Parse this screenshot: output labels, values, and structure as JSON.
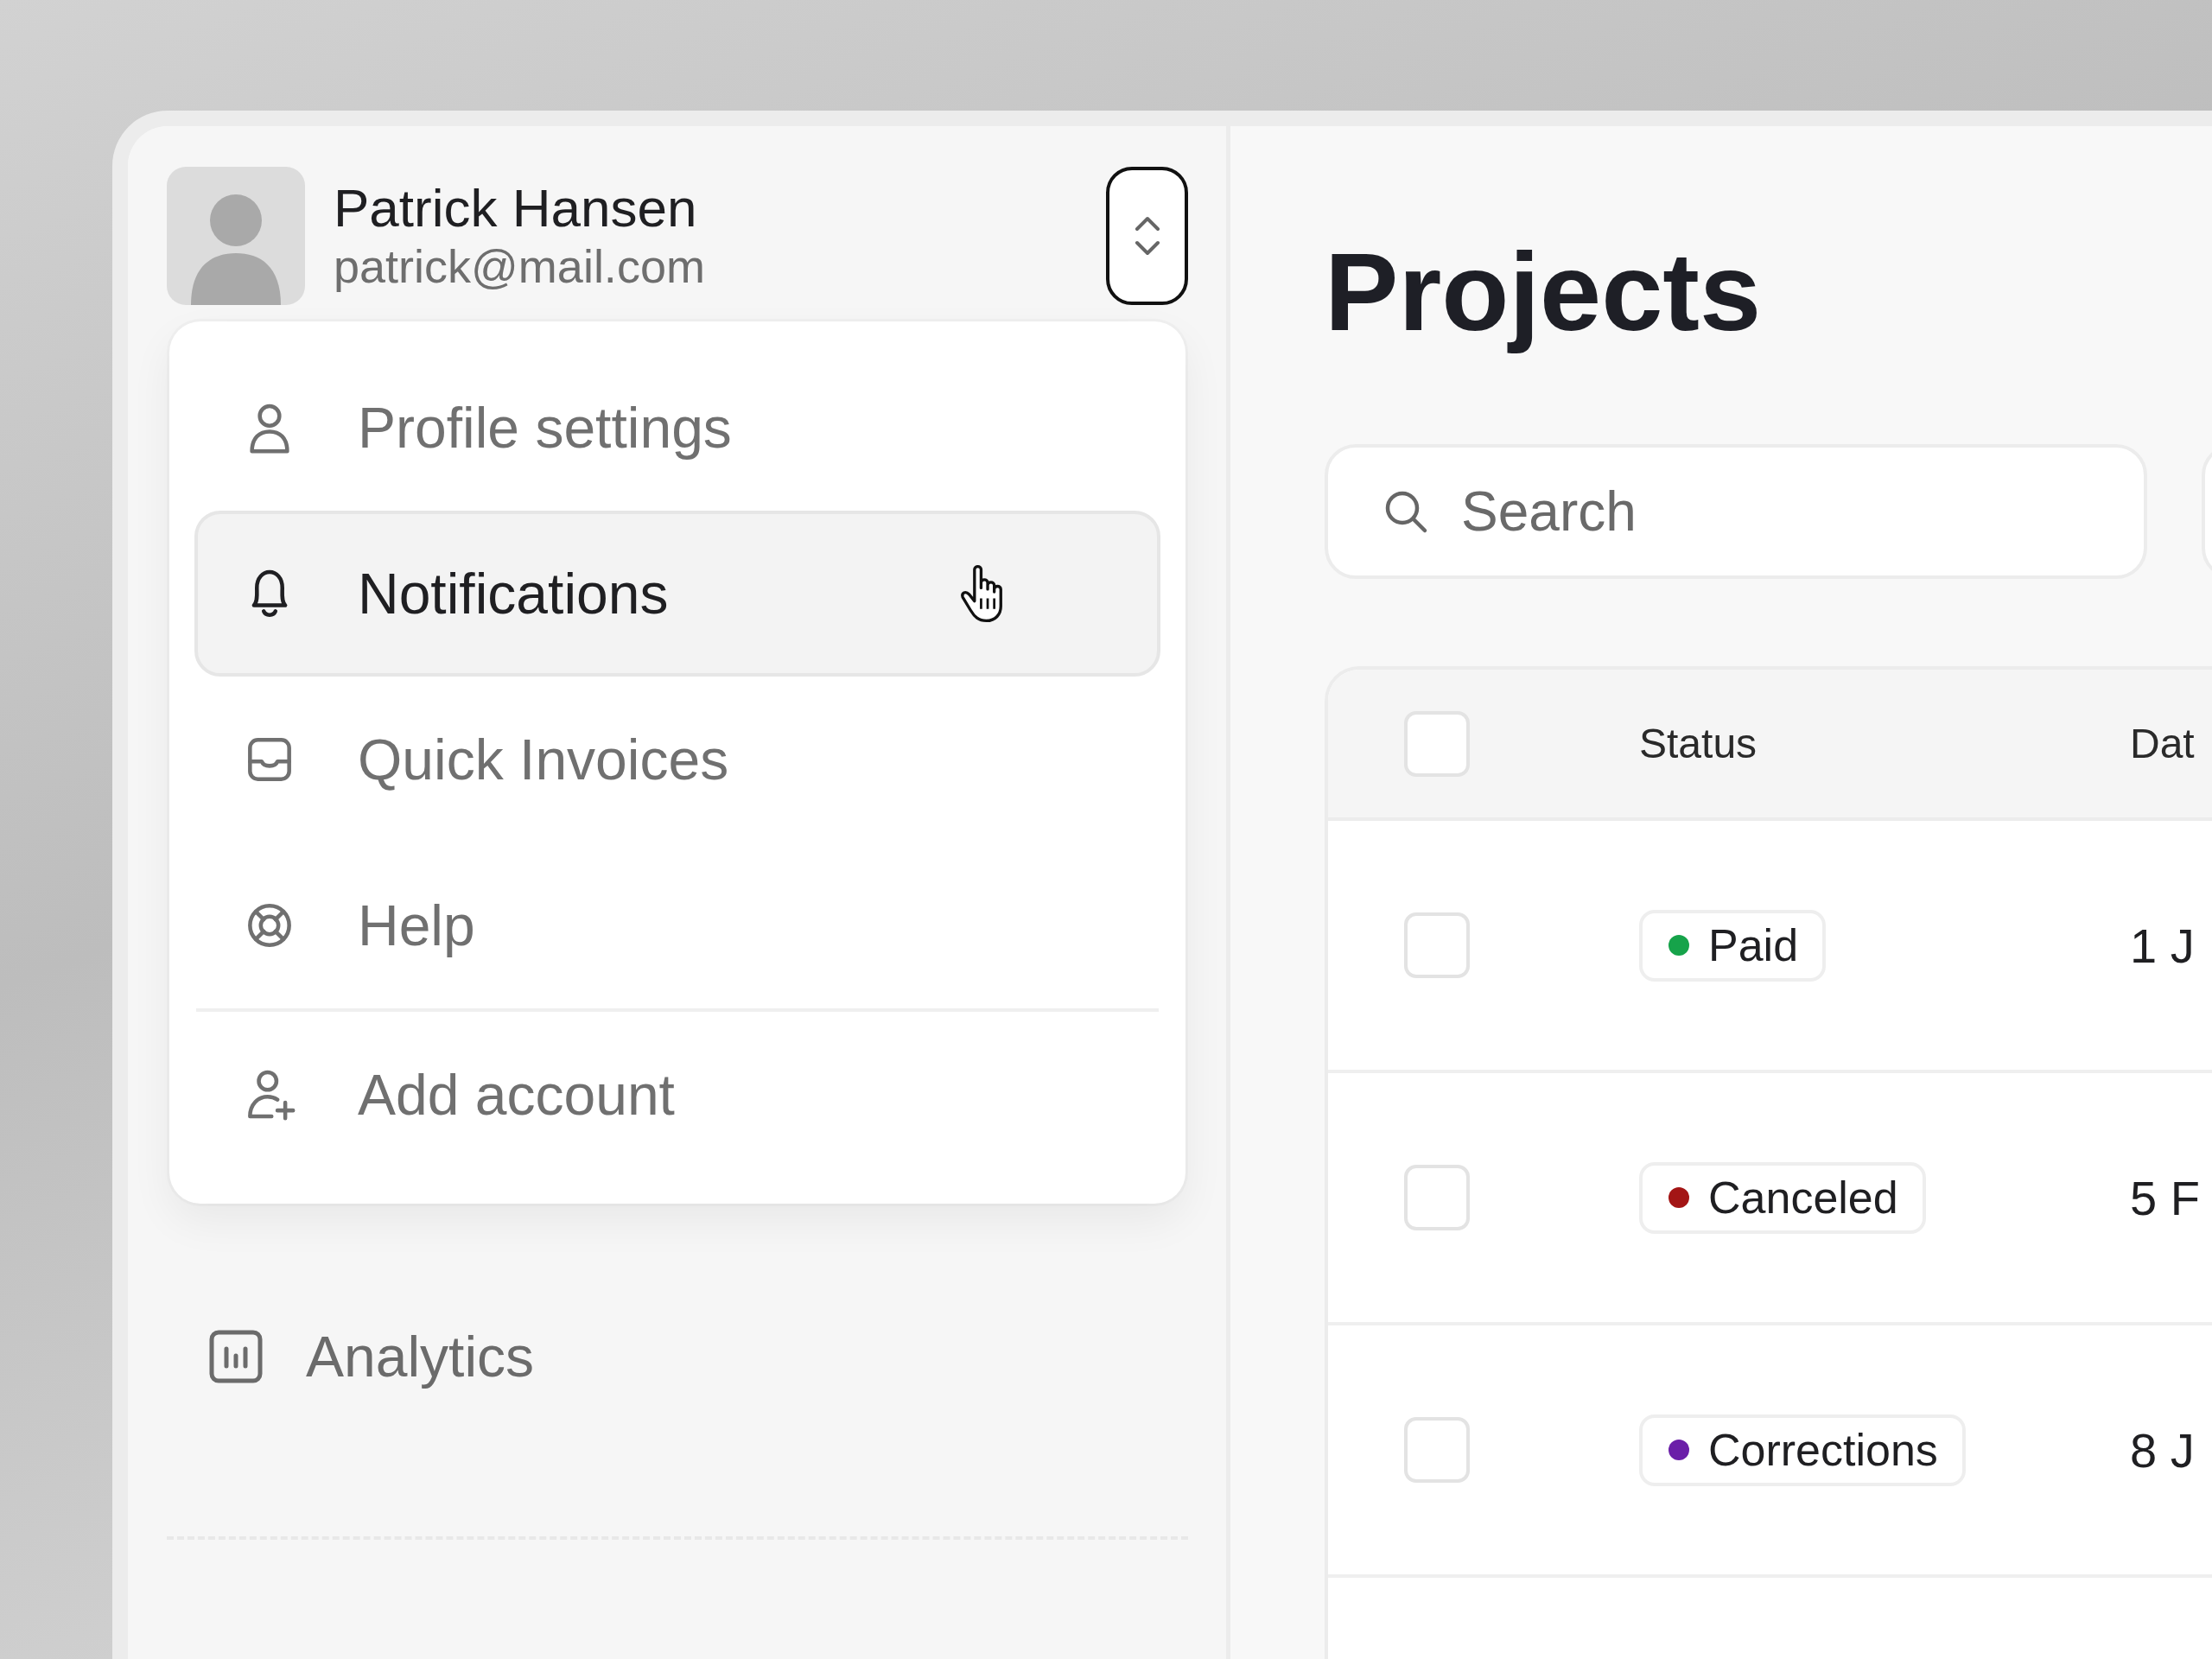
{
  "account": {
    "name": "Patrick Hansen",
    "email": "patrick@mail.com"
  },
  "menu": {
    "sections": [
      {
        "items": [
          {
            "label": "Profile settings",
            "selected": false
          },
          {
            "label": "Notifications",
            "selected": true
          },
          {
            "label": "Quick Invoices",
            "selected": false
          },
          {
            "label": "Help",
            "selected": false
          }
        ]
      },
      {
        "items": [
          {
            "label": "Add account",
            "selected": false
          }
        ]
      }
    ]
  },
  "sidebar": {
    "items": [
      {
        "label": "Analytics"
      }
    ]
  },
  "main": {
    "title": "Projects",
    "search": {
      "placeholder": "Search"
    },
    "table": {
      "header_checked": false,
      "columns": [
        "Status",
        "Dat"
      ],
      "rows": [
        {
          "checked": false,
          "status": "Paid",
          "color": "#16a34a",
          "date": "1 J"
        },
        {
          "checked": false,
          "status": "Canceled",
          "color": "#a31515",
          "date": "5 F"
        },
        {
          "checked": false,
          "status": "Corrections",
          "color": "#6b1fa8",
          "date": "8 J"
        }
      ]
    }
  }
}
